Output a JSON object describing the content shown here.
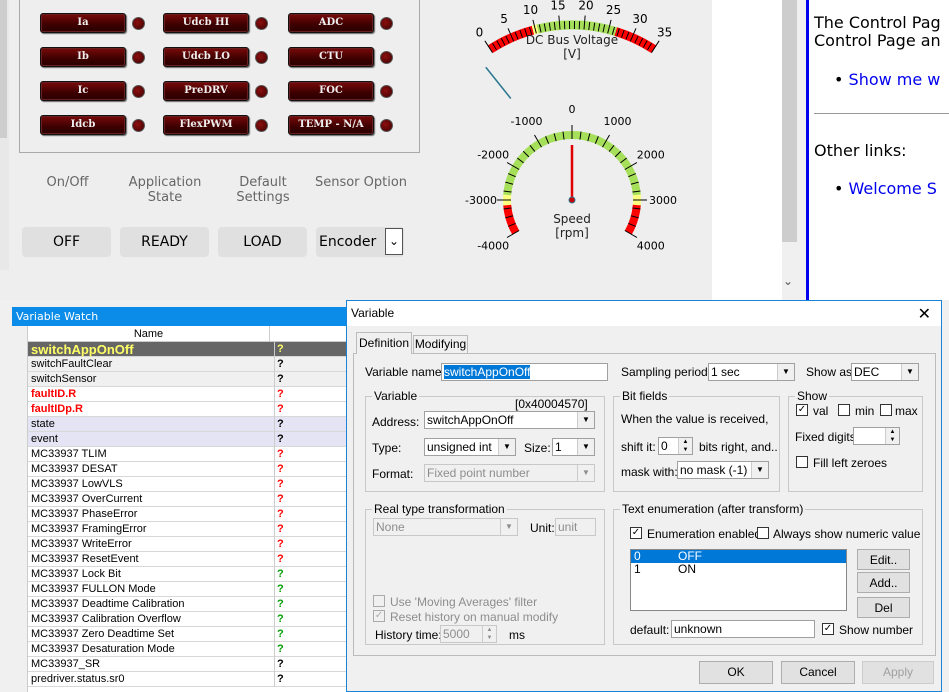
{
  "fault_panel": {
    "buttons": [
      [
        "Ia",
        "Udcb HI",
        "ADC"
      ],
      [
        "Ib",
        "Udcb LO",
        "CTU"
      ],
      [
        "Ic",
        "PreDRV",
        "FOC"
      ],
      [
        "Idcb",
        "FlexPWM",
        "TEMP - N/A"
      ]
    ]
  },
  "controls": {
    "labels": [
      "On/Off",
      "Application\nState",
      "Default\nSettings",
      "Sensor Option"
    ],
    "onoff": "OFF",
    "app_state": "READY",
    "defaults": "LOAD",
    "sensor_option": "Encoder"
  },
  "gauges": {
    "voltage": {
      "title": "DC Bus Voltage",
      "unit": "[V]",
      "min": 0,
      "max": 35,
      "tick_labels": [
        "0",
        "5",
        "10",
        "15",
        "20",
        "25",
        "30",
        "35"
      ],
      "value": -3,
      "red_low": 9.5,
      "yellow_low": 10.5,
      "green_high": 26.5,
      "colors": {
        "red": "#ff0000",
        "yellow": "#ffff80",
        "green": "#a6e05a"
      }
    },
    "speed": {
      "title": "Speed",
      "unit": "[rpm]",
      "min": -4000,
      "max": 4000,
      "tick_labels": [
        "-4000",
        "-3000",
        "-2000",
        "-1000",
        "0",
        "1000",
        "2000",
        "3000",
        "4000"
      ],
      "value": 0,
      "red": 3150,
      "yellow": 2850
    }
  },
  "help": {
    "line1": "The Control Pag",
    "line2": "Control Page an",
    "link1": "Show me w",
    "other": "Other links:",
    "link2": "Welcome S"
  },
  "watch": {
    "title": "Variable Watch",
    "col_name": "Name",
    "rows": [
      {
        "name": "switchAppOnOff",
        "value": "?",
        "style": "selected"
      },
      {
        "name": "switchFaultClear",
        "value": "?",
        "style": "gray"
      },
      {
        "name": "switchSensor",
        "value": "?",
        "style": "gray"
      },
      {
        "name": "faultID.R",
        "value": "?",
        "style": "red"
      },
      {
        "name": "faultIDp.R",
        "value": "?",
        "style": "red"
      },
      {
        "name": "state",
        "value": "?",
        "style": "lav"
      },
      {
        "name": "event",
        "value": "?",
        "style": "lav"
      },
      {
        "name": "MC33937 TLIM",
        "value": "?",
        "style": "redval"
      },
      {
        "name": "MC33937 DESAT",
        "value": "?",
        "style": "redval"
      },
      {
        "name": "MC33937 LowVLS",
        "value": "?",
        "style": "redval"
      },
      {
        "name": "MC33937 OverCurrent",
        "value": "?",
        "style": "redval"
      },
      {
        "name": "MC33937 PhaseError",
        "value": "?",
        "style": "redval"
      },
      {
        "name": "MC33937 FramingError",
        "value": "?",
        "style": "redval"
      },
      {
        "name": "MC33937 WriteError",
        "value": "?",
        "style": "redval"
      },
      {
        "name": "MC33937 ResetEvent",
        "value": "?",
        "style": "redval"
      },
      {
        "name": "MC33937 Lock Bit",
        "value": "?",
        "style": "greenval"
      },
      {
        "name": "MC33937 FULLON Mode",
        "value": "?",
        "style": "greenval"
      },
      {
        "name": "MC33937 Deadtime Calibration",
        "value": "?",
        "style": "greenval"
      },
      {
        "name": "MC33937 Calibration Overflow",
        "value": "?",
        "style": "greenval"
      },
      {
        "name": "MC33937 Zero Deadtime Set",
        "value": "?",
        "style": "greenval"
      },
      {
        "name": "MC33937 Desaturation Mode",
        "value": "?",
        "style": "greenval"
      },
      {
        "name": "MC33937_SR",
        "value": "?",
        "style": "plain"
      },
      {
        "name": "predriver.status.sr0",
        "value": "?",
        "style": "plain"
      }
    ]
  },
  "dialog": {
    "title": "Variable",
    "tabs": [
      "Definition",
      "Modifying"
    ],
    "var_name_label": "Variable name:",
    "var_name": "switchAppOnOff",
    "sampling_label": "Sampling period:",
    "sampling": "1 sec",
    "showas_label": "Show as:",
    "showas": "DEC",
    "variable": {
      "title": "Variable",
      "address_hex": "[0x40004570]",
      "address_label": "Address:",
      "address": "switchAppOnOff",
      "type_label": "Type:",
      "type": "unsigned int",
      "size_label": "Size:",
      "size": "1",
      "format_label": "Format:",
      "format": "Fixed point number"
    },
    "bitfields": {
      "title": "Bit fields",
      "text": "When the value is received,",
      "shift_label": "shift it:",
      "shift": "0",
      "shift_suffix": "bits right, and..",
      "mask_label": "mask with:",
      "mask": "no mask (-1)"
    },
    "show": {
      "title": "Show",
      "val": "val",
      "min": "min",
      "max": "max",
      "val_checked": true,
      "min_checked": false,
      "max_checked": false,
      "fixed_label": "Fixed digits:",
      "fill": "Fill left zeroes",
      "fill_checked": false
    },
    "real": {
      "title": "Real type transformation",
      "transform": "None",
      "unit_label": "Unit:",
      "unit_placeholder": "unit",
      "moving": "Use 'Moving Averages' filter",
      "reset": "Reset history on manual modify",
      "history_label": "History time:",
      "history": "5000",
      "ms": "ms"
    },
    "enum": {
      "title": "Text enumeration (after transform)",
      "enabled": "Enumeration enabled",
      "always": "Always show numeric value",
      "items": [
        {
          "value": "0",
          "text": "OFF"
        },
        {
          "value": "1",
          "text": "ON"
        }
      ],
      "edit": "Edit..",
      "add": "Add..",
      "del": "Del",
      "default_label": "default:",
      "default": "unknown",
      "show_number": "Show number"
    },
    "ok": "OK",
    "cancel": "Cancel",
    "apply": "Apply"
  }
}
